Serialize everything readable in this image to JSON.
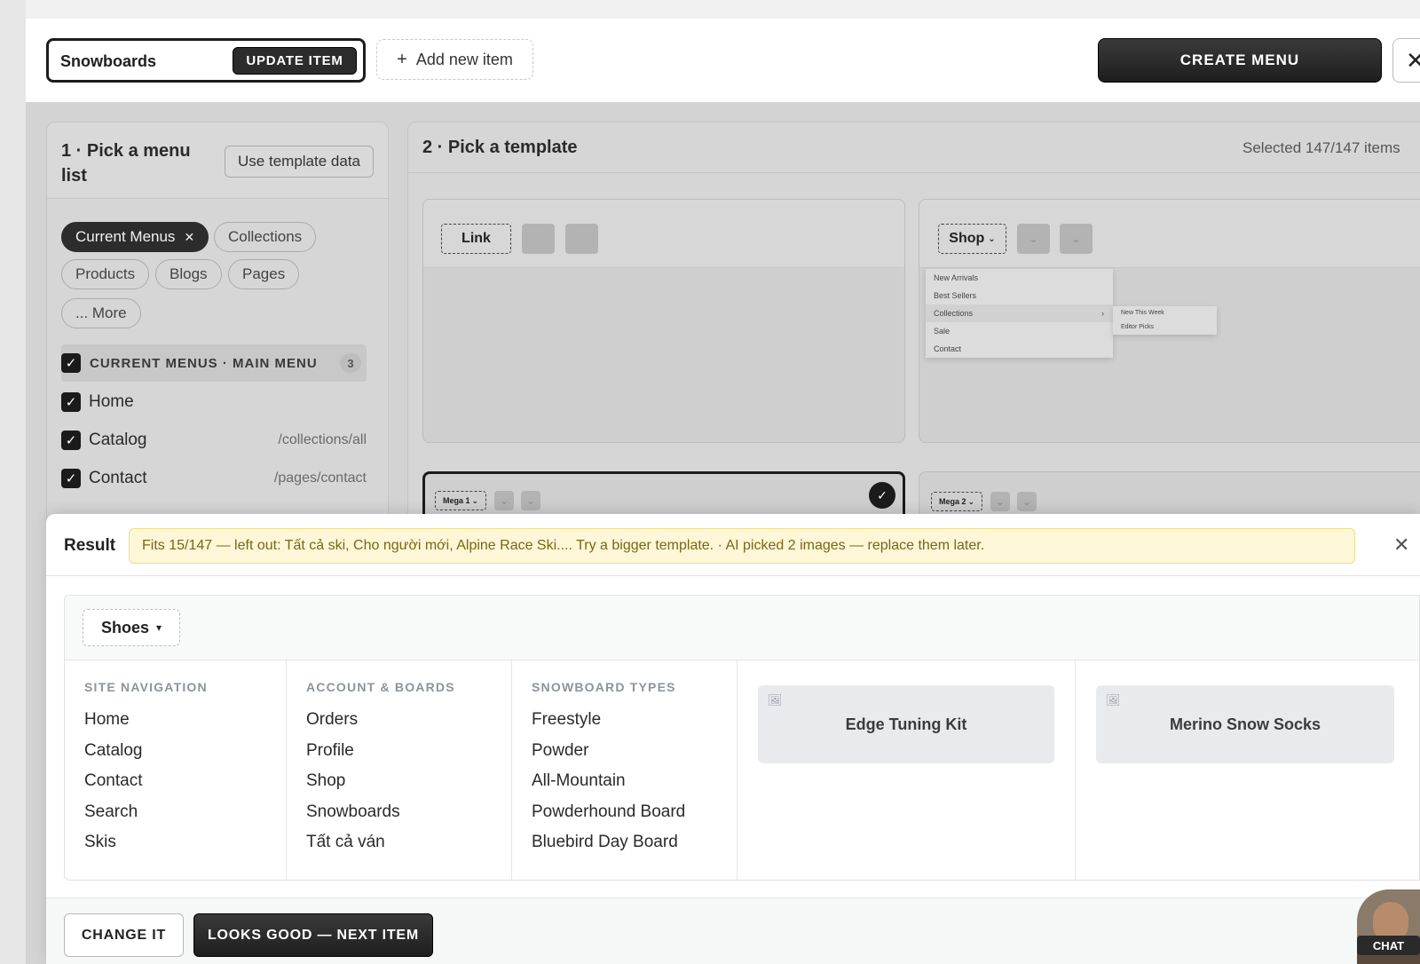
{
  "header": {
    "item_name": "Snowboards",
    "update_label": "UPDATE ITEM",
    "add_new_label": "Add new item",
    "create_menu_label": "CREATE MENU",
    "close_glyph": "✕"
  },
  "panel1": {
    "title": "1 · Pick a menu list",
    "use_template_label": "Use template data",
    "chips": [
      {
        "label": "Current Menus",
        "active": true
      },
      {
        "label": "Collections",
        "active": false
      },
      {
        "label": "Products",
        "active": false
      },
      {
        "label": "Blogs",
        "active": false
      },
      {
        "label": "Pages",
        "active": false
      },
      {
        "label": "... More",
        "active": false
      }
    ],
    "group": {
      "label": "CURRENT MENUS · MAIN MENU",
      "count": "3",
      "checked": true
    },
    "items": [
      {
        "label": "Home",
        "path": "",
        "checked": true
      },
      {
        "label": "Catalog",
        "path": "/collections/all",
        "checked": true
      },
      {
        "label": "Contact",
        "path": "/pages/contact",
        "checked": true
      }
    ]
  },
  "panel2": {
    "title": "2 · Pick a template",
    "selected_text": "Selected 147/147 items",
    "templates": [
      {
        "trigger": "Link"
      },
      {
        "trigger": "Shop",
        "dropdown": [
          "New Arrivals",
          "Best Sellers",
          "Collections",
          "Sale",
          "Contact"
        ],
        "submenu": [
          "New This Week",
          "Editor Picks"
        ]
      },
      {
        "trigger": "Mega 1",
        "selected": true
      },
      {
        "trigger": "Mega 2"
      }
    ]
  },
  "result": {
    "label": "Result",
    "notice": "Fits 15/147 — left out: Tất cả ski, Cho người mới, Alpine Race Ski.... Try a bigger template. · AI picked 2 images — replace them later.",
    "close_glyph": "✕",
    "trigger": "Shoes",
    "columns": [
      {
        "heading": "SITE NAVIGATION",
        "links": [
          "Home",
          "Catalog",
          "Contact",
          "Search",
          "Skis"
        ]
      },
      {
        "heading": "ACCOUNT & BOARDS",
        "links": [
          "Orders",
          "Profile",
          "Shop",
          "Snowboards",
          "Tất cả ván"
        ]
      },
      {
        "heading": "SNOWBOARD TYPES",
        "links": [
          "Freestyle",
          "Powder",
          "All-Mountain",
          "Powderhound Board",
          "Bluebird Day Board"
        ]
      }
    ],
    "products": [
      {
        "title": "Edge Tuning Kit",
        "icon": "image-placeholder-icon"
      },
      {
        "title": "Merino Snow Socks",
        "icon": "image-placeholder-icon"
      }
    ],
    "change_label": "CHANGE IT",
    "next_label": "LOOKS GOOD — NEXT ITEM"
  },
  "chat": {
    "label": "CHAT"
  }
}
